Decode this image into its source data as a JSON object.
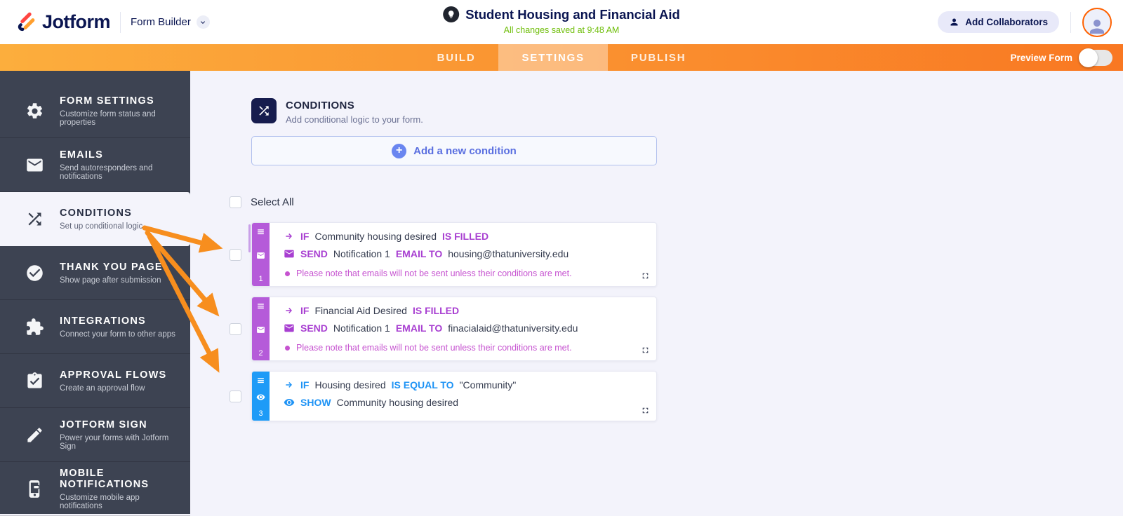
{
  "header": {
    "brand": "Jotform",
    "product": "Form Builder",
    "form_title": "Student Housing and Financial Aid",
    "save_status": "All changes saved at 9:48 AM",
    "add_collaborators": "Add Collaborators"
  },
  "nav": {
    "tabs": [
      {
        "label": "BUILD",
        "active": false
      },
      {
        "label": "SETTINGS",
        "active": true
      },
      {
        "label": "PUBLISH",
        "active": false
      }
    ],
    "preview_label": "Preview Form",
    "preview_on": false
  },
  "sidebar": {
    "items": [
      {
        "id": "form-settings",
        "icon": "gear",
        "label": "FORM SETTINGS",
        "desc": "Customize form status and properties",
        "active": false
      },
      {
        "id": "emails",
        "icon": "mail",
        "label": "EMAILS",
        "desc": "Send autoresponders and notifications",
        "active": false
      },
      {
        "id": "conditions",
        "icon": "shuffle",
        "label": "CONDITIONS",
        "desc": "Set up conditional logic",
        "active": true
      },
      {
        "id": "thank-you-page",
        "icon": "check-circle",
        "label": "THANK YOU PAGE",
        "desc": "Show page after submission",
        "active": false
      },
      {
        "id": "integrations",
        "icon": "puzzle",
        "label": "INTEGRATIONS",
        "desc": "Connect your form to other apps",
        "active": false
      },
      {
        "id": "approval-flows",
        "icon": "doc-check",
        "label": "APPROVAL FLOWS",
        "desc": "Create an approval flow",
        "active": false
      },
      {
        "id": "jotform-sign",
        "icon": "pen",
        "label": "JOTFORM SIGN",
        "desc": "Power your forms with Jotform Sign",
        "active": false
      },
      {
        "id": "mobile-notifications",
        "icon": "phone",
        "label": "MOBILE NOTIFICATIONS",
        "desc": "Customize mobile app notifications",
        "active": false
      }
    ]
  },
  "main": {
    "section_title": "CONDITIONS",
    "section_subtitle": "Add conditional logic to your form.",
    "add_button": "Add a new condition",
    "select_all": "Select All",
    "select_all_checked": false,
    "conditions": [
      {
        "number": "1",
        "checked": false,
        "accent": "#b55bd9",
        "keyword_color": "#a83fd1",
        "note_color": "#c653d0",
        "type_icon": "mail",
        "rows": [
          {
            "icon": "arrow",
            "parts": [
              {
                "t": "IF",
                "k": "kw"
              },
              {
                "t": "Community housing desired",
                "k": "val"
              },
              {
                "t": "IS FILLED",
                "k": "kw"
              }
            ]
          },
          {
            "icon": "mail",
            "parts": [
              {
                "t": "SEND",
                "k": "kw"
              },
              {
                "t": "Notification 1",
                "k": "val"
              },
              {
                "t": "EMAIL TO",
                "k": "kw"
              },
              {
                "t": "housing@thatuniversity.edu",
                "k": "val"
              }
            ]
          }
        ],
        "note": "Please note that emails will not be sent unless their conditions are met."
      },
      {
        "number": "2",
        "checked": false,
        "accent": "#b55bd9",
        "keyword_color": "#a83fd1",
        "note_color": "#c653d0",
        "type_icon": "mail",
        "rows": [
          {
            "icon": "arrow",
            "parts": [
              {
                "t": "IF",
                "k": "kw"
              },
              {
                "t": "Financial Aid Desired",
                "k": "val"
              },
              {
                "t": "IS FILLED",
                "k": "kw"
              }
            ]
          },
          {
            "icon": "mail",
            "parts": [
              {
                "t": "SEND",
                "k": "kw"
              },
              {
                "t": "Notification 1",
                "k": "val"
              },
              {
                "t": "EMAIL TO",
                "k": "kw"
              },
              {
                "t": "finacialaid@thatuniversity.edu",
                "k": "val"
              }
            ]
          }
        ],
        "note": "Please note that emails will not be sent unless their conditions are met."
      },
      {
        "number": "3",
        "checked": false,
        "accent": "#1e9bf7",
        "keyword_color": "#1e93f5",
        "note_color": "",
        "type_icon": "eye",
        "rows": [
          {
            "icon": "arrow",
            "parts": [
              {
                "t": "IF",
                "k": "kw"
              },
              {
                "t": "Housing desired",
                "k": "val"
              },
              {
                "t": "IS EQUAL TO",
                "k": "kw"
              },
              {
                "t": "\"Community\"",
                "k": "val"
              }
            ]
          },
          {
            "icon": "eye",
            "parts": [
              {
                "t": "SHOW",
                "k": "kw"
              },
              {
                "t": "Community housing desired",
                "k": "val"
              }
            ]
          }
        ],
        "note": ""
      }
    ]
  },
  "colors": {
    "navy": "#0a1551",
    "orange_bar_start": "#fcae3d",
    "orange_bar_end": "#f97822",
    "annotation_arrow": "#f78e1e",
    "purple": "#b55bd9",
    "blue": "#1e9bf7",
    "green_status": "#6fbe0a",
    "sidebar_bg": "#3d4352"
  }
}
